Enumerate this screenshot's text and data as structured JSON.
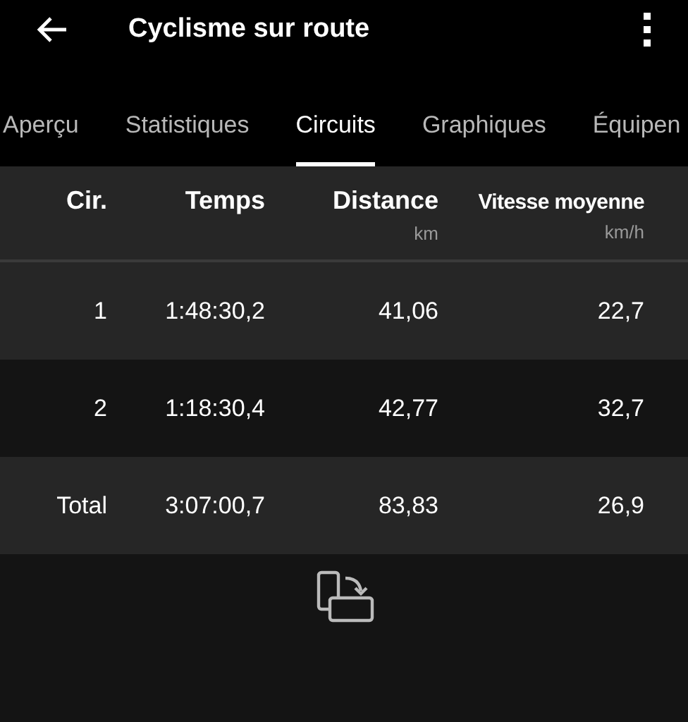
{
  "app_bar": {
    "title": "Cyclisme sur route"
  },
  "tabs": [
    {
      "label": "Aperçu",
      "selected": false
    },
    {
      "label": "Statistiques",
      "selected": false
    },
    {
      "label": "Circuits",
      "selected": true
    },
    {
      "label": "Graphiques",
      "selected": false
    },
    {
      "label": "Équipen",
      "selected": false
    }
  ],
  "table": {
    "columns": [
      {
        "label": "Cir."
      },
      {
        "label": "Temps"
      },
      {
        "label": "Distance",
        "unit": "km"
      },
      {
        "label": "Vitesse moyenne",
        "unit": "km/h"
      }
    ],
    "rows": [
      [
        "1",
        "1:48:30,2",
        "41,06",
        "22,7"
      ],
      [
        "2",
        "1:18:30,4",
        "42,77",
        "32,7"
      ],
      [
        "Total",
        "3:07:00,7",
        "83,83",
        "26,9"
      ]
    ]
  }
}
